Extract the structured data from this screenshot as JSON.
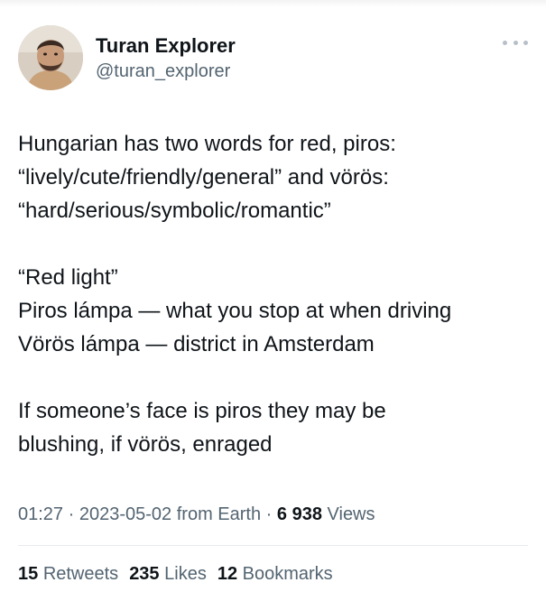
{
  "author": {
    "display_name": "Turan Explorer",
    "handle": "@turan_explorer",
    "avatar_icon": "user-photo-avatar"
  },
  "tweet": {
    "lines": [
      "Hungarian has two words for red, piros:",
      "“lively/cute/friendly/general” and vörös:",
      "“hard/serious/symbolic/romantic”",
      "“Red light”",
      "Piros lámpa — what you stop at when driving",
      "Vörös lámpa — district in Amsterdam",
      "If someone’s face is piros they may be",
      "blushing, if vörös, enraged"
    ]
  },
  "meta": {
    "time": "01:27",
    "separator": "·",
    "date": "2023-05-02",
    "source": "from Earth",
    "views_count": "6 938",
    "views_label": "Views"
  },
  "stats": {
    "retweets_count": "15",
    "retweets_label": "Retweets",
    "likes_count": "235",
    "likes_label": "Likes",
    "bookmarks_count": "12",
    "bookmarks_label": "Bookmarks"
  },
  "colors": {
    "text": "#0f1419",
    "secondary": "#536471",
    "divider": "#e7eaee"
  }
}
